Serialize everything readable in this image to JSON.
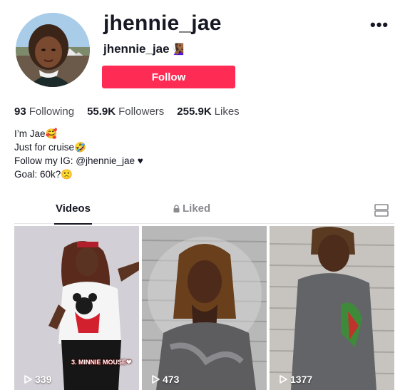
{
  "profile": {
    "username": "jhennie_jae",
    "handle": "jhennie_jae",
    "handle_emoji": "🧏🏾‍♀️",
    "follow_label": "Follow",
    "more_label": "•••"
  },
  "stats": {
    "following_count": "93",
    "following_label": "Following",
    "followers_count": "55.9K",
    "followers_label": "Followers",
    "likes_count": "255.9K",
    "likes_label": "Likes"
  },
  "bio": {
    "line1": "I’m Jae🥰",
    "line2": "Just for cruise🤣",
    "line3": "Follow my IG: @jhennie_jae ♥",
    "line4": "Goal: 60k?🙁"
  },
  "tabs": {
    "videos": "Videos",
    "liked": "Liked"
  },
  "videos": [
    {
      "views": "339",
      "caption": "3. MINNIE MOUSE❤"
    },
    {
      "views": "473"
    },
    {
      "views": "1377"
    }
  ],
  "colors": {
    "accent": "#fe2c55",
    "text": "#161823",
    "muted": "#8a8b91"
  }
}
